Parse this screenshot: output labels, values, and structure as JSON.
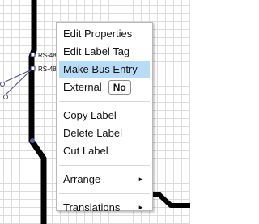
{
  "canvas": {
    "net_labels": [
      "RS-48",
      "RS-48"
    ]
  },
  "context_menu": {
    "items": [
      {
        "label": "Edit Properties"
      },
      {
        "label": "Edit Label Tag"
      },
      {
        "label": "Make Bus Entry",
        "highlighted": true
      },
      {
        "label": "External",
        "toggle_value": "No"
      },
      {
        "label": "Copy Label"
      },
      {
        "label": "Delete Label"
      },
      {
        "label": "Cut Label"
      },
      {
        "label": "Arrange",
        "submenu_arrow": "►"
      },
      {
        "label": "Translations",
        "submenu_arrow": "►"
      }
    ]
  },
  "colors": {
    "highlight": "#b9dcf6",
    "wire": "#000000",
    "grid": "#dcdcdc"
  }
}
